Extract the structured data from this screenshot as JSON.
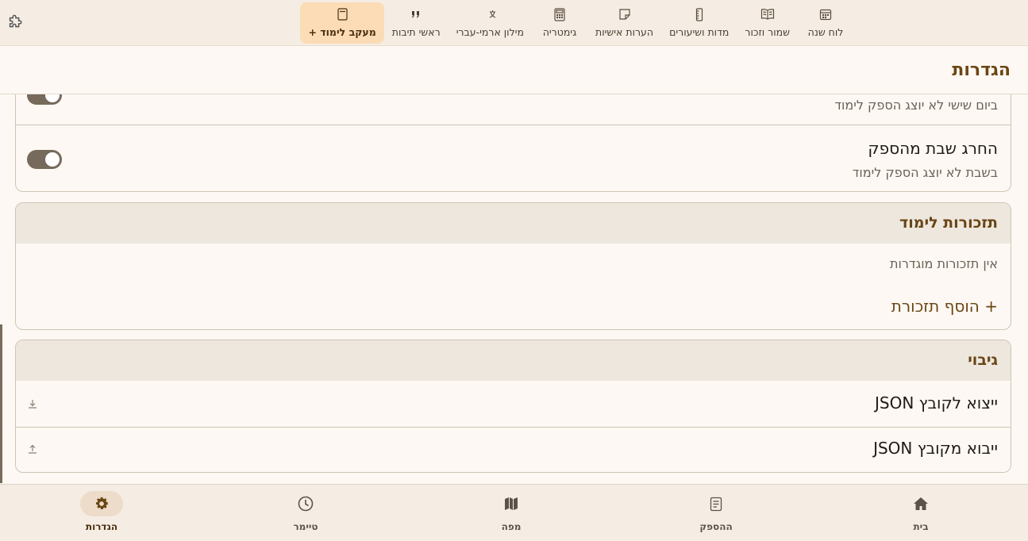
{
  "toolbar": {
    "extension_icon": "puzzle-icon",
    "items": [
      {
        "label": "לוח שנה",
        "icon": "calendar-icon"
      },
      {
        "label": "שמור וזכור",
        "icon": "book-open-icon"
      },
      {
        "label": "מדות ושיעורים",
        "icon": "ruler-icon"
      },
      {
        "label": "הערות אישיות",
        "icon": "sticky-note-icon"
      },
      {
        "label": "גימטריה",
        "icon": "calculator-icon"
      },
      {
        "label": "מילון ארמי-עברי",
        "icon": "translate-icon"
      },
      {
        "label": "ראשי תיבות",
        "icon": "quote-icon"
      },
      {
        "label": "מעקב לימוד +",
        "icon": "notebook-icon",
        "active": true
      }
    ]
  },
  "header": {
    "title": "הגדרות"
  },
  "shabbat_card": {
    "partial_subtitle": "ביום שישי לא יוצג הספק לימוד",
    "exclude_shabbat_title": "החרג שבת מהספק",
    "exclude_shabbat_subtitle": "בשבת לא יוצג הספק לימוד",
    "toggles": {
      "friday": true,
      "shabbat": true
    }
  },
  "reminders_card": {
    "title": "תזכורות לימוד",
    "empty_text": "אין תזכורות מוגדרות",
    "add_label": "+ הוסף תזכורת"
  },
  "backup_card": {
    "title": "גיבוי",
    "export_label": "ייצוא לקובץ JSON",
    "import_label": "ייבוא מקובץ JSON"
  },
  "bottom_nav": {
    "items": [
      {
        "label": "בית",
        "icon": "home-icon"
      },
      {
        "label": "ההספק",
        "icon": "document-icon"
      },
      {
        "label": "מפה",
        "icon": "map-icon"
      },
      {
        "label": "טיימר",
        "icon": "clock-icon"
      },
      {
        "label": "הגדרות",
        "icon": "gear-icon",
        "active": true
      }
    ]
  },
  "colors": {
    "accent": "#6a4514",
    "active_tab_bg": "#fbdcb6",
    "toggle_on": "#766a5c",
    "background": "#fdf8f3"
  }
}
